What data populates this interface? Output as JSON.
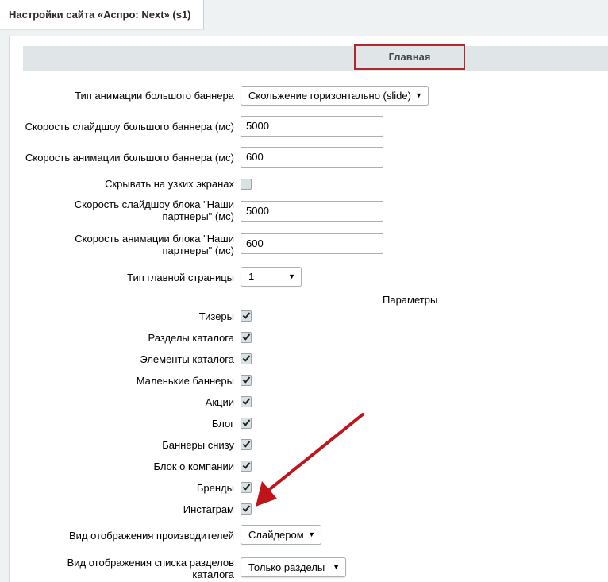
{
  "tab": {
    "title": "Настройки сайта «Аспро: Next» (s1)"
  },
  "section": {
    "title": "Главная"
  },
  "fields": {
    "banner_animation_type": {
      "label": "Тип анимации большого баннера",
      "value": "Скольжение горизонтально (slide)"
    },
    "banner_slideshow_speed": {
      "label": "Скорость слайдшоу большого баннера (мс)",
      "value": "5000"
    },
    "banner_animation_speed": {
      "label": "Скорость анимации большого баннера (мс)",
      "value": "600"
    },
    "hide_narrow": {
      "label": "Скрывать на узких экранах",
      "checked": false
    },
    "partners_slideshow_speed": {
      "label_line1": "Скорость слайдшоу блока \"Наши",
      "label_line2": "партнеры\" (мс)",
      "value": "5000"
    },
    "partners_animation_speed": {
      "label_line1": "Скорость анимации блока \"Наши",
      "label_line2": "партнеры\" (мс)",
      "value": "600"
    },
    "main_page_type": {
      "label": "Тип главной страницы",
      "value": "1"
    },
    "parameters_heading": "Параметры",
    "params": [
      {
        "label": "Тизеры",
        "checked": true
      },
      {
        "label": "Разделы каталога",
        "checked": true
      },
      {
        "label": "Элементы каталога",
        "checked": true
      },
      {
        "label": "Маленькие баннеры",
        "checked": true
      },
      {
        "label": "Акции",
        "checked": true
      },
      {
        "label": "Блог",
        "checked": true
      },
      {
        "label": "Баннеры снизу",
        "checked": true
      },
      {
        "label": "Блок о компании",
        "checked": true
      },
      {
        "label": "Бренды",
        "checked": true
      },
      {
        "label": "Инстаграм",
        "checked": true
      }
    ],
    "manufacturers_view": {
      "label": "Вид отображения производителей",
      "value": "Слайдером"
    },
    "catalog_sections_view": {
      "label_line1": "Вид отображения списка разделов",
      "label_line2": "каталога",
      "value": "Только разделы"
    }
  },
  "colors": {
    "highlight": "#b0282f",
    "arrow": "#c0141c"
  }
}
